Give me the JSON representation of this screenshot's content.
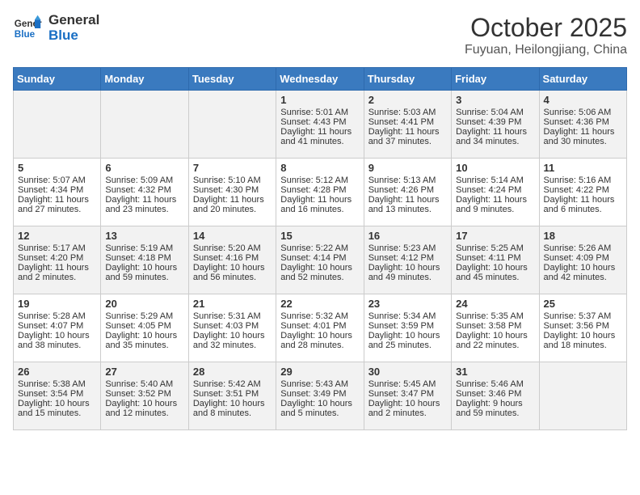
{
  "header": {
    "logo_line1": "General",
    "logo_line2": "Blue",
    "month": "October 2025",
    "location": "Fuyuan, Heilongjiang, China"
  },
  "weekdays": [
    "Sunday",
    "Monday",
    "Tuesday",
    "Wednesday",
    "Thursday",
    "Friday",
    "Saturday"
  ],
  "weeks": [
    [
      {
        "day": "",
        "info": ""
      },
      {
        "day": "",
        "info": ""
      },
      {
        "day": "",
        "info": ""
      },
      {
        "day": "1",
        "info": "Sunrise: 5:01 AM\nSunset: 4:43 PM\nDaylight: 11 hours\nand 41 minutes."
      },
      {
        "day": "2",
        "info": "Sunrise: 5:03 AM\nSunset: 4:41 PM\nDaylight: 11 hours\nand 37 minutes."
      },
      {
        "day": "3",
        "info": "Sunrise: 5:04 AM\nSunset: 4:39 PM\nDaylight: 11 hours\nand 34 minutes."
      },
      {
        "day": "4",
        "info": "Sunrise: 5:06 AM\nSunset: 4:36 PM\nDaylight: 11 hours\nand 30 minutes."
      }
    ],
    [
      {
        "day": "5",
        "info": "Sunrise: 5:07 AM\nSunset: 4:34 PM\nDaylight: 11 hours\nand 27 minutes."
      },
      {
        "day": "6",
        "info": "Sunrise: 5:09 AM\nSunset: 4:32 PM\nDaylight: 11 hours\nand 23 minutes."
      },
      {
        "day": "7",
        "info": "Sunrise: 5:10 AM\nSunset: 4:30 PM\nDaylight: 11 hours\nand 20 minutes."
      },
      {
        "day": "8",
        "info": "Sunrise: 5:12 AM\nSunset: 4:28 PM\nDaylight: 11 hours\nand 16 minutes."
      },
      {
        "day": "9",
        "info": "Sunrise: 5:13 AM\nSunset: 4:26 PM\nDaylight: 11 hours\nand 13 minutes."
      },
      {
        "day": "10",
        "info": "Sunrise: 5:14 AM\nSunset: 4:24 PM\nDaylight: 11 hours\nand 9 minutes."
      },
      {
        "day": "11",
        "info": "Sunrise: 5:16 AM\nSunset: 4:22 PM\nDaylight: 11 hours\nand 6 minutes."
      }
    ],
    [
      {
        "day": "12",
        "info": "Sunrise: 5:17 AM\nSunset: 4:20 PM\nDaylight: 11 hours\nand 2 minutes."
      },
      {
        "day": "13",
        "info": "Sunrise: 5:19 AM\nSunset: 4:18 PM\nDaylight: 10 hours\nand 59 minutes."
      },
      {
        "day": "14",
        "info": "Sunrise: 5:20 AM\nSunset: 4:16 PM\nDaylight: 10 hours\nand 56 minutes."
      },
      {
        "day": "15",
        "info": "Sunrise: 5:22 AM\nSunset: 4:14 PM\nDaylight: 10 hours\nand 52 minutes."
      },
      {
        "day": "16",
        "info": "Sunrise: 5:23 AM\nSunset: 4:12 PM\nDaylight: 10 hours\nand 49 minutes."
      },
      {
        "day": "17",
        "info": "Sunrise: 5:25 AM\nSunset: 4:11 PM\nDaylight: 10 hours\nand 45 minutes."
      },
      {
        "day": "18",
        "info": "Sunrise: 5:26 AM\nSunset: 4:09 PM\nDaylight: 10 hours\nand 42 minutes."
      }
    ],
    [
      {
        "day": "19",
        "info": "Sunrise: 5:28 AM\nSunset: 4:07 PM\nDaylight: 10 hours\nand 38 minutes."
      },
      {
        "day": "20",
        "info": "Sunrise: 5:29 AM\nSunset: 4:05 PM\nDaylight: 10 hours\nand 35 minutes."
      },
      {
        "day": "21",
        "info": "Sunrise: 5:31 AM\nSunset: 4:03 PM\nDaylight: 10 hours\nand 32 minutes."
      },
      {
        "day": "22",
        "info": "Sunrise: 5:32 AM\nSunset: 4:01 PM\nDaylight: 10 hours\nand 28 minutes."
      },
      {
        "day": "23",
        "info": "Sunrise: 5:34 AM\nSunset: 3:59 PM\nDaylight: 10 hours\nand 25 minutes."
      },
      {
        "day": "24",
        "info": "Sunrise: 5:35 AM\nSunset: 3:58 PM\nDaylight: 10 hours\nand 22 minutes."
      },
      {
        "day": "25",
        "info": "Sunrise: 5:37 AM\nSunset: 3:56 PM\nDaylight: 10 hours\nand 18 minutes."
      }
    ],
    [
      {
        "day": "26",
        "info": "Sunrise: 5:38 AM\nSunset: 3:54 PM\nDaylight: 10 hours\nand 15 minutes."
      },
      {
        "day": "27",
        "info": "Sunrise: 5:40 AM\nSunset: 3:52 PM\nDaylight: 10 hours\nand 12 minutes."
      },
      {
        "day": "28",
        "info": "Sunrise: 5:42 AM\nSunset: 3:51 PM\nDaylight: 10 hours\nand 8 minutes."
      },
      {
        "day": "29",
        "info": "Sunrise: 5:43 AM\nSunset: 3:49 PM\nDaylight: 10 hours\nand 5 minutes."
      },
      {
        "day": "30",
        "info": "Sunrise: 5:45 AM\nSunset: 3:47 PM\nDaylight: 10 hours\nand 2 minutes."
      },
      {
        "day": "31",
        "info": "Sunrise: 5:46 AM\nSunset: 3:46 PM\nDaylight: 9 hours\nand 59 minutes."
      },
      {
        "day": "",
        "info": ""
      }
    ]
  ]
}
